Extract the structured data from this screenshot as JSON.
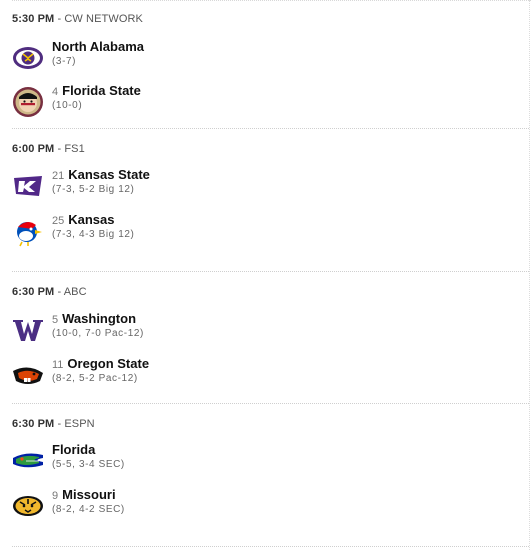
{
  "games": [
    {
      "time": "5:30 PM",
      "network": "CW NETWORK",
      "teams": [
        {
          "rank": "",
          "name": "North Alabama",
          "record": "(3-7)",
          "logo": "north-alabama-lion-logo",
          "color": "#4f2d7f"
        },
        {
          "rank": "4",
          "name": "Florida State",
          "record": "(10-0)",
          "logo": "florida-state-seminole-logo",
          "color": "#782f40"
        }
      ]
    },
    {
      "time": "6:00 PM",
      "network": "FS1",
      "teams": [
        {
          "rank": "21",
          "name": "Kansas State",
          "record": "(7-3, 5-2 Big 12)",
          "logo": "kansas-state-wildcat-logo",
          "color": "#512888"
        },
        {
          "rank": "25",
          "name": "Kansas",
          "record": "(7-3, 4-3 Big 12)",
          "logo": "kansas-jayhawk-logo",
          "color": "#0051ba"
        }
      ]
    },
    {
      "time": "6:30 PM",
      "network": "ABC",
      "teams": [
        {
          "rank": "5",
          "name": "Washington",
          "record": "(10-0, 7-0 Pac-12)",
          "logo": "washington-w-logo",
          "color": "#4b2e83"
        },
        {
          "rank": "11",
          "name": "Oregon State",
          "record": "(8-2, 5-2 Pac-12)",
          "logo": "oregon-state-beaver-logo",
          "color": "#dc4405"
        }
      ]
    },
    {
      "time": "6:30 PM",
      "network": "ESPN",
      "teams": [
        {
          "rank": "",
          "name": "Florida",
          "record": "(5-5, 3-4 SEC)",
          "logo": "florida-gator-logo",
          "color": "#0021a5"
        },
        {
          "rank": "9",
          "name": "Missouri",
          "record": "(8-2, 4-2 SEC)",
          "logo": "missouri-tiger-logo",
          "color": "#f1b82d"
        }
      ]
    }
  ]
}
